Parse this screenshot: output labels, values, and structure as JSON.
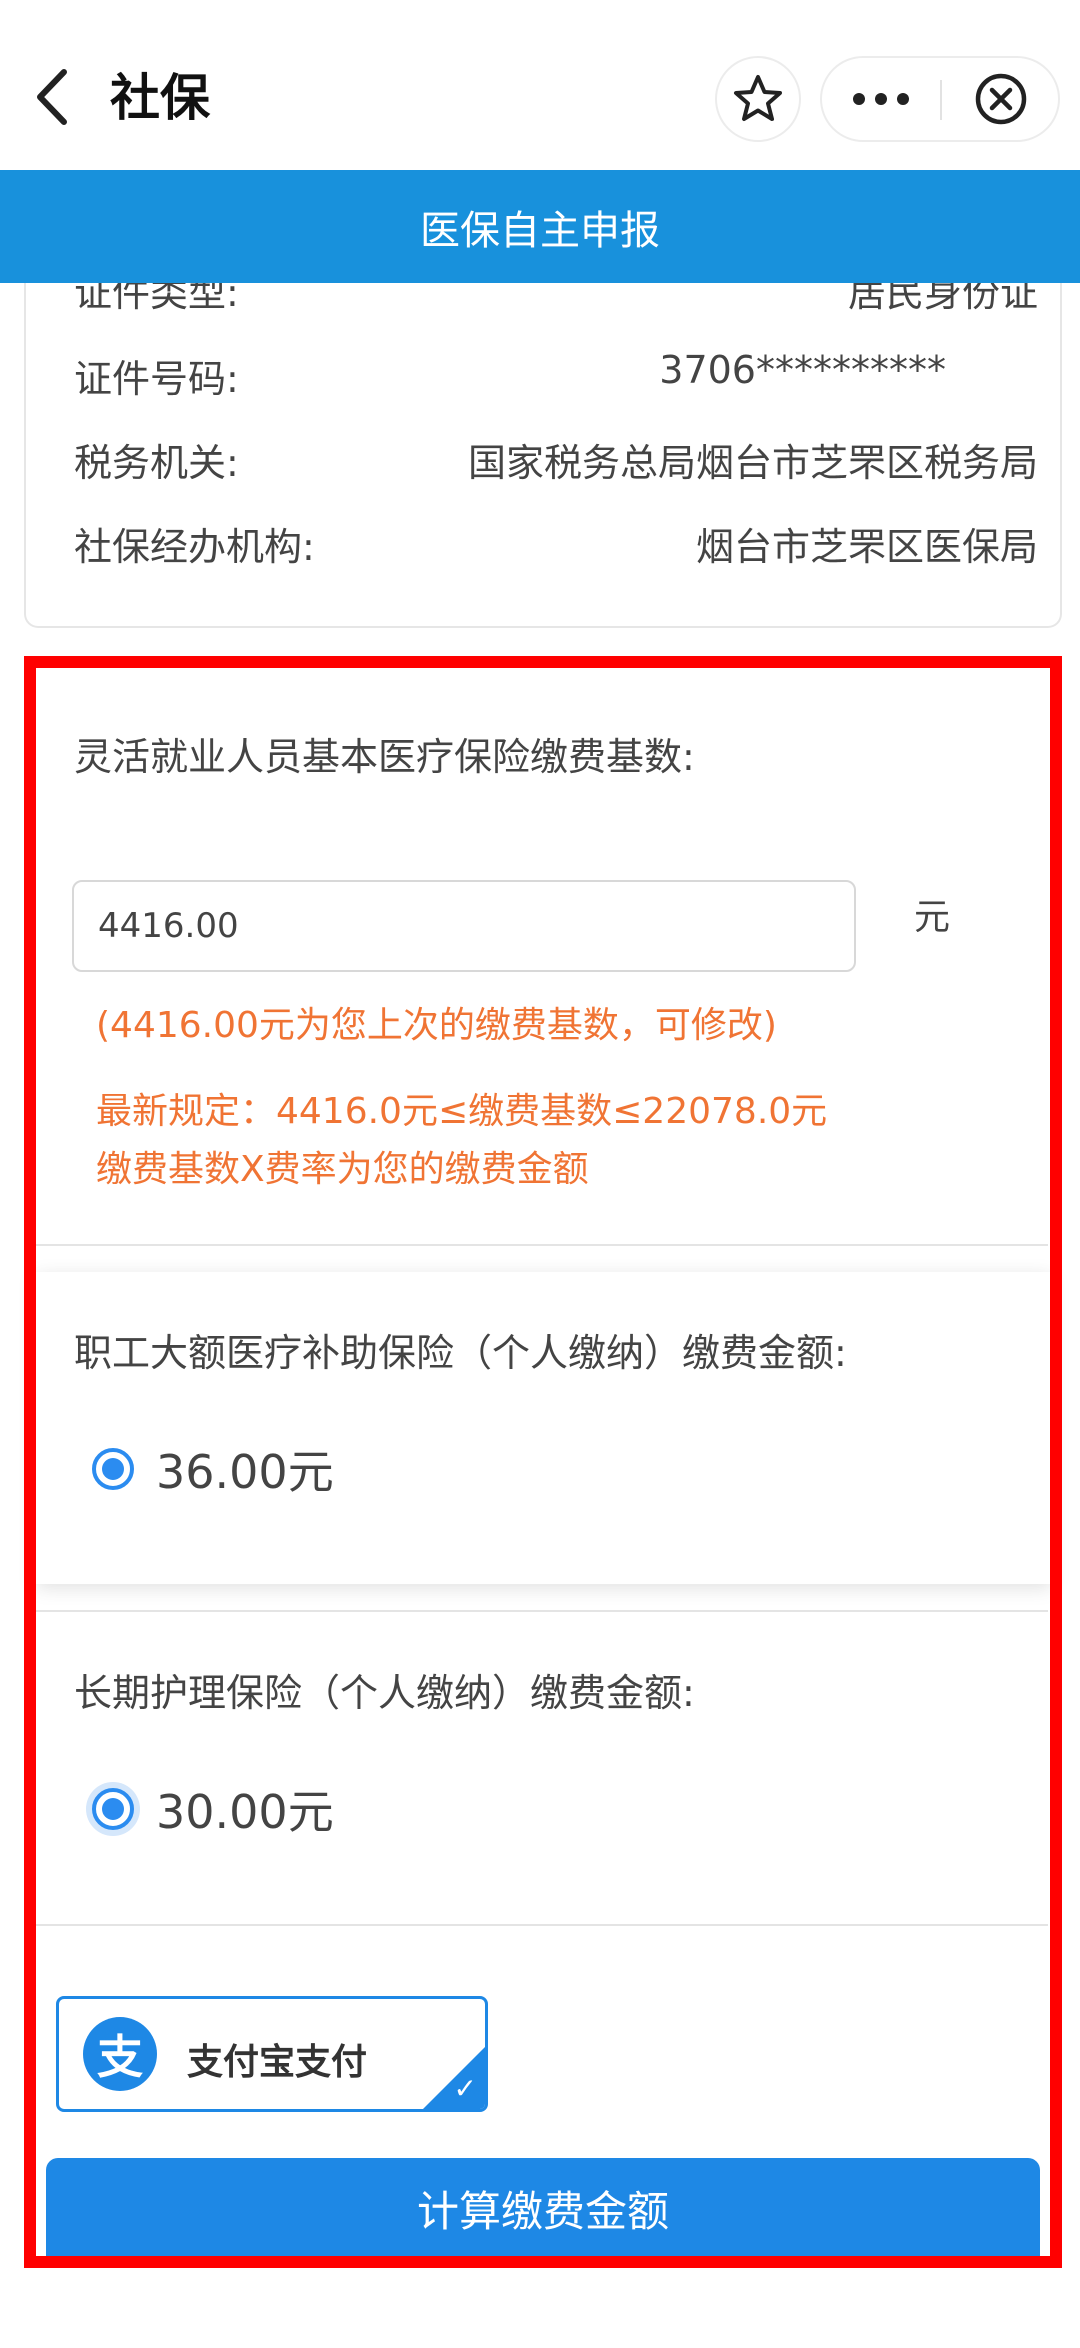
{
  "navbar": {
    "title": "社保",
    "back_icon": "chevron-left-icon",
    "star_icon": "star-outline-icon",
    "more_icon": "more-dots-icon",
    "close_icon": "close-circle-icon"
  },
  "header": {
    "title": "医保自主申报"
  },
  "info": {
    "rows": [
      {
        "label": "证件类型:",
        "value": "居民身份证"
      },
      {
        "label": "证件号码:",
        "value": "3706**********"
      },
      {
        "label": "税务机关:",
        "value": "国家税务总局烟台市芝罘区税务局"
      },
      {
        "label": "社保经办机构:",
        "value": "烟台市芝罘区医保局"
      }
    ]
  },
  "base": {
    "label": "灵活就业人员基本医疗保险缴费基数:",
    "value": "4416.00",
    "unit": "元",
    "note1": "(4416.00元为您上次的缴费基数，可修改)",
    "note2": "最新规定：4416.0元≤缴费基数≤22078.0元",
    "note3": "缴费基数X费率为您的缴费金额"
  },
  "large_medical": {
    "label": "职工大额医疗补助保险（个人缴纳）缴费金额:",
    "option": "36.00元",
    "selected": true
  },
  "long_term_care": {
    "label": "长期护理保险（个人缴纳）缴费金额:",
    "option": "30.00元",
    "selected": true
  },
  "payment": {
    "method": "支付宝支付",
    "logo_char": "支",
    "selected": true
  },
  "actions": {
    "calculate_label": "计算缴费金额"
  },
  "colors": {
    "header_blue": "#1891dc",
    "button_blue": "#1e88e5",
    "note_orange": "#f07434",
    "highlight_red": "#ff0000"
  }
}
